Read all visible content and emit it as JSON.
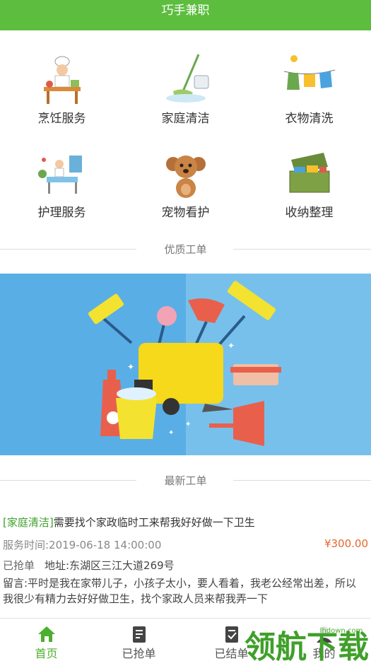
{
  "app": {
    "title": "巧手兼职"
  },
  "services": [
    {
      "label": "烹饪服务",
      "icon": "chef-cooking-icon"
    },
    {
      "label": "家庭清洁",
      "icon": "mop-bucket-icon"
    },
    {
      "label": "衣物清洗",
      "icon": "clothesline-icon"
    },
    {
      "label": "护理服务",
      "icon": "nursing-care-icon"
    },
    {
      "label": "宠物看护",
      "icon": "puppy-icon"
    },
    {
      "label": "收纳整理",
      "icon": "storage-box-icon"
    }
  ],
  "sections": {
    "quality": "优质工单",
    "latest": "最新工单"
  },
  "order": {
    "tag": "[家庭清洁]",
    "title": "需要找个家政临时工来帮我好好做一下卫生",
    "service_time": "服务时间:2019-06-18 14:00:00",
    "price": "¥300.00",
    "status": "已抢单",
    "address": "地址:东湖区三江大道269号",
    "note": "留言:平时是我在家带儿子，小孩子太小，要人看着，我老公经常出差，所以我很少有精力去好好做卫生，找个家政人员来帮我弄一下"
  },
  "tabs": [
    {
      "label": "首页",
      "icon": "home-icon",
      "active": true
    },
    {
      "label": "已抢单",
      "icon": "order-clipboard-icon",
      "active": false
    },
    {
      "label": "已结单",
      "icon": "completed-clipboard-icon",
      "active": false
    },
    {
      "label": "我的",
      "icon": "profile-icon",
      "active": false
    }
  ],
  "watermark": {
    "text": "领航下载",
    "site": "lhdown.com"
  },
  "colors": {
    "brand_green": "#5cbd3f",
    "price_orange": "#e8662d",
    "banner_blue": "#5aaee6"
  }
}
